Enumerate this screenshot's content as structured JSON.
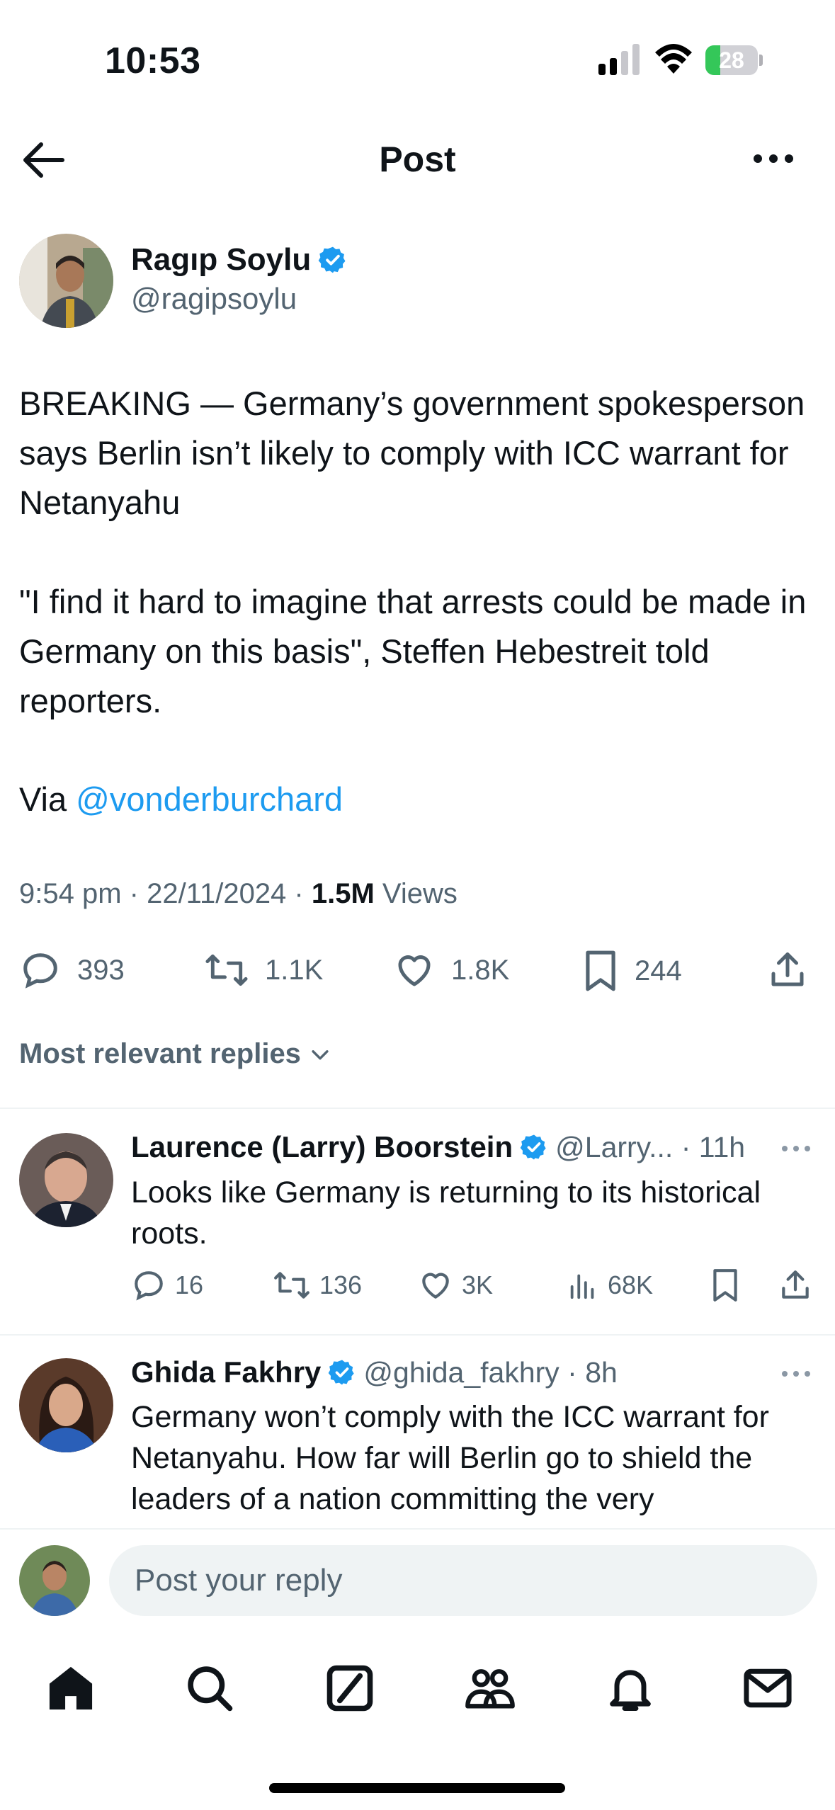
{
  "status_bar": {
    "time": "10:53",
    "battery": "28",
    "battery_level": 0.28
  },
  "header": {
    "title": "Post"
  },
  "post": {
    "author_name": "Ragıp Soylu",
    "author_handle": "@ragipsoylu",
    "paragraph1": "BREAKING — Germany’s government spokesperson says Berlin isn’t likely to comply with ICC warrant for Netanyahu",
    "paragraph2": "\"I find it hard to imagine that arrests could be made in Germany on this basis\", Steffen Hebestreit told reporters.",
    "via_prefix": "Via ",
    "via_link": "@vonderburchard",
    "timestamp": "9:54 pm · 22/11/2024 · ",
    "views_count": "1.5M",
    "views_label": " Views",
    "actions": {
      "replies": "393",
      "reposts": "1.1K",
      "likes": "1.8K",
      "bookmarks": "244"
    }
  },
  "replies_filter": "Most relevant replies",
  "replies": [
    {
      "name": "Laurence (Larry) Boorstein",
      "handle": "@Larry... · 11h",
      "text": "Looks like Germany is returning to its historical roots.",
      "replies": "16",
      "reposts": "136",
      "likes": "3K",
      "views": "68K"
    },
    {
      "name": "Ghida Fakhry",
      "handle": "@ghida_fakhry · 8h",
      "text": "Germany won’t comply with the ICC warrant for Netanyahu. How far will Berlin go to shield the leaders of a nation committing the very"
    }
  ],
  "composer": {
    "placeholder": "Post your reply"
  },
  "colors": {
    "accent": "#1d9bf0",
    "secondary_text": "#536471",
    "battery_green": "#34c759"
  },
  "tabs": [
    "home-icon",
    "search-icon",
    "grok-icon",
    "communities-icon",
    "notifications-icon",
    "messages-icon"
  ]
}
